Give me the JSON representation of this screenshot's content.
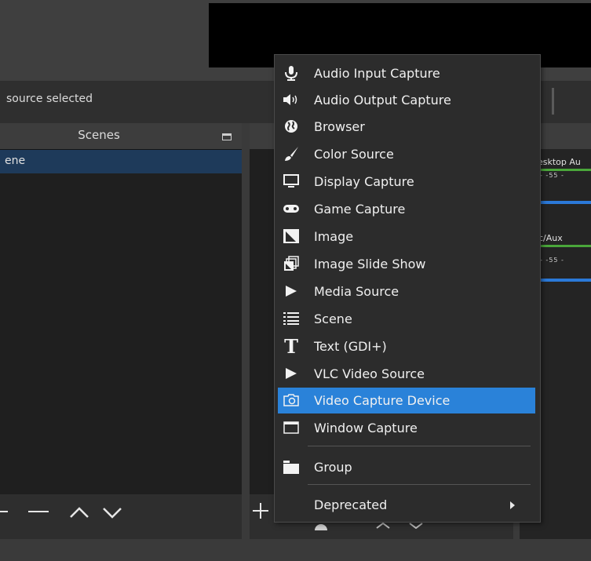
{
  "status_bar": {
    "source_text": "source selected"
  },
  "scenes": {
    "title": "Scenes",
    "items": [
      {
        "label": "ene"
      }
    ]
  },
  "mixer": {
    "channels": [
      {
        "label": "esktop Au",
        "ticks": "-  -55  -"
      },
      {
        "label": "c/Aux",
        "ticks": "-  -55  -"
      }
    ]
  },
  "add_source_menu": {
    "items": [
      {
        "label": "Audio Input Capture",
        "icon": "microphone-icon"
      },
      {
        "label": "Audio Output Capture",
        "icon": "speaker-icon"
      },
      {
        "label": "Browser",
        "icon": "globe-icon"
      },
      {
        "label": "Color Source",
        "icon": "paintbrush-icon"
      },
      {
        "label": "Display Capture",
        "icon": "monitor-icon"
      },
      {
        "label": "Game Capture",
        "icon": "gamepad-icon"
      },
      {
        "label": "Image",
        "icon": "image-icon"
      },
      {
        "label": "Image Slide Show",
        "icon": "slideshow-icon"
      },
      {
        "label": "Media Source",
        "icon": "play-icon"
      },
      {
        "label": "Scene",
        "icon": "list-icon"
      },
      {
        "label": "Text (GDI+)",
        "icon": "text-icon"
      },
      {
        "label": "VLC Video Source",
        "icon": "play-icon"
      },
      {
        "label": "Video Capture Device",
        "icon": "camera-icon",
        "selected": true
      },
      {
        "label": "Window Capture",
        "icon": "window-icon"
      },
      {
        "label": "Group",
        "icon": "folder-icon"
      },
      {
        "label": "Deprecated",
        "icon": "",
        "has_submenu": true
      }
    ]
  },
  "colors": {
    "selection": "#2a82d9",
    "scene_selection": "#1e3a5a",
    "meter_green": "#4aa63a",
    "slider_blue": "#2b79d8"
  }
}
